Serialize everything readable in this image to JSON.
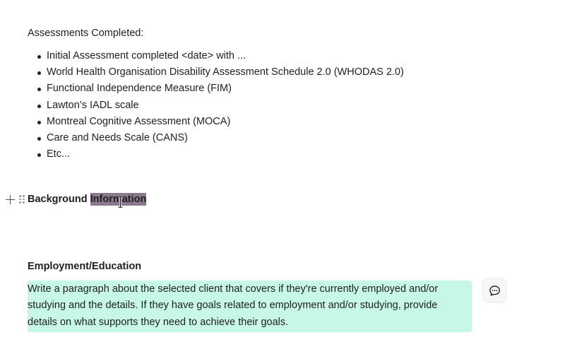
{
  "assessments": {
    "label": "Assessments Completed:",
    "items": [
      "Initial Assessment completed <date> with ...",
      "World Health Organisation Disability Assessment Schedule 2.0 (WHODAS 2.0)",
      "Functional Independence Measure (FIM)",
      "Lawton’s IADL scale",
      "Montreal Cognitive Assessment (MOCA)",
      "Care and Needs Scale (CANS)",
      "Etc..."
    ]
  },
  "background": {
    "heading_plain": "Background ",
    "heading_selected": "Information"
  },
  "employment": {
    "heading": "Employment/Education",
    "paragraph_lines": [
      "Write a paragraph about the selected client that covers if they're currently employed and/or",
      "studying and the details. If they have goals related to employment and/or studying, provide",
      "details on what supports they need to achieve their goals."
    ]
  },
  "colors": {
    "highlight": "#c7f7e6",
    "selection": "#8a7a8f"
  },
  "icons": {
    "add_block": "plus-icon",
    "drag_handle": "drag-handle-icon",
    "comment": "comment-icon",
    "text_cursor": "text-cursor-icon"
  }
}
